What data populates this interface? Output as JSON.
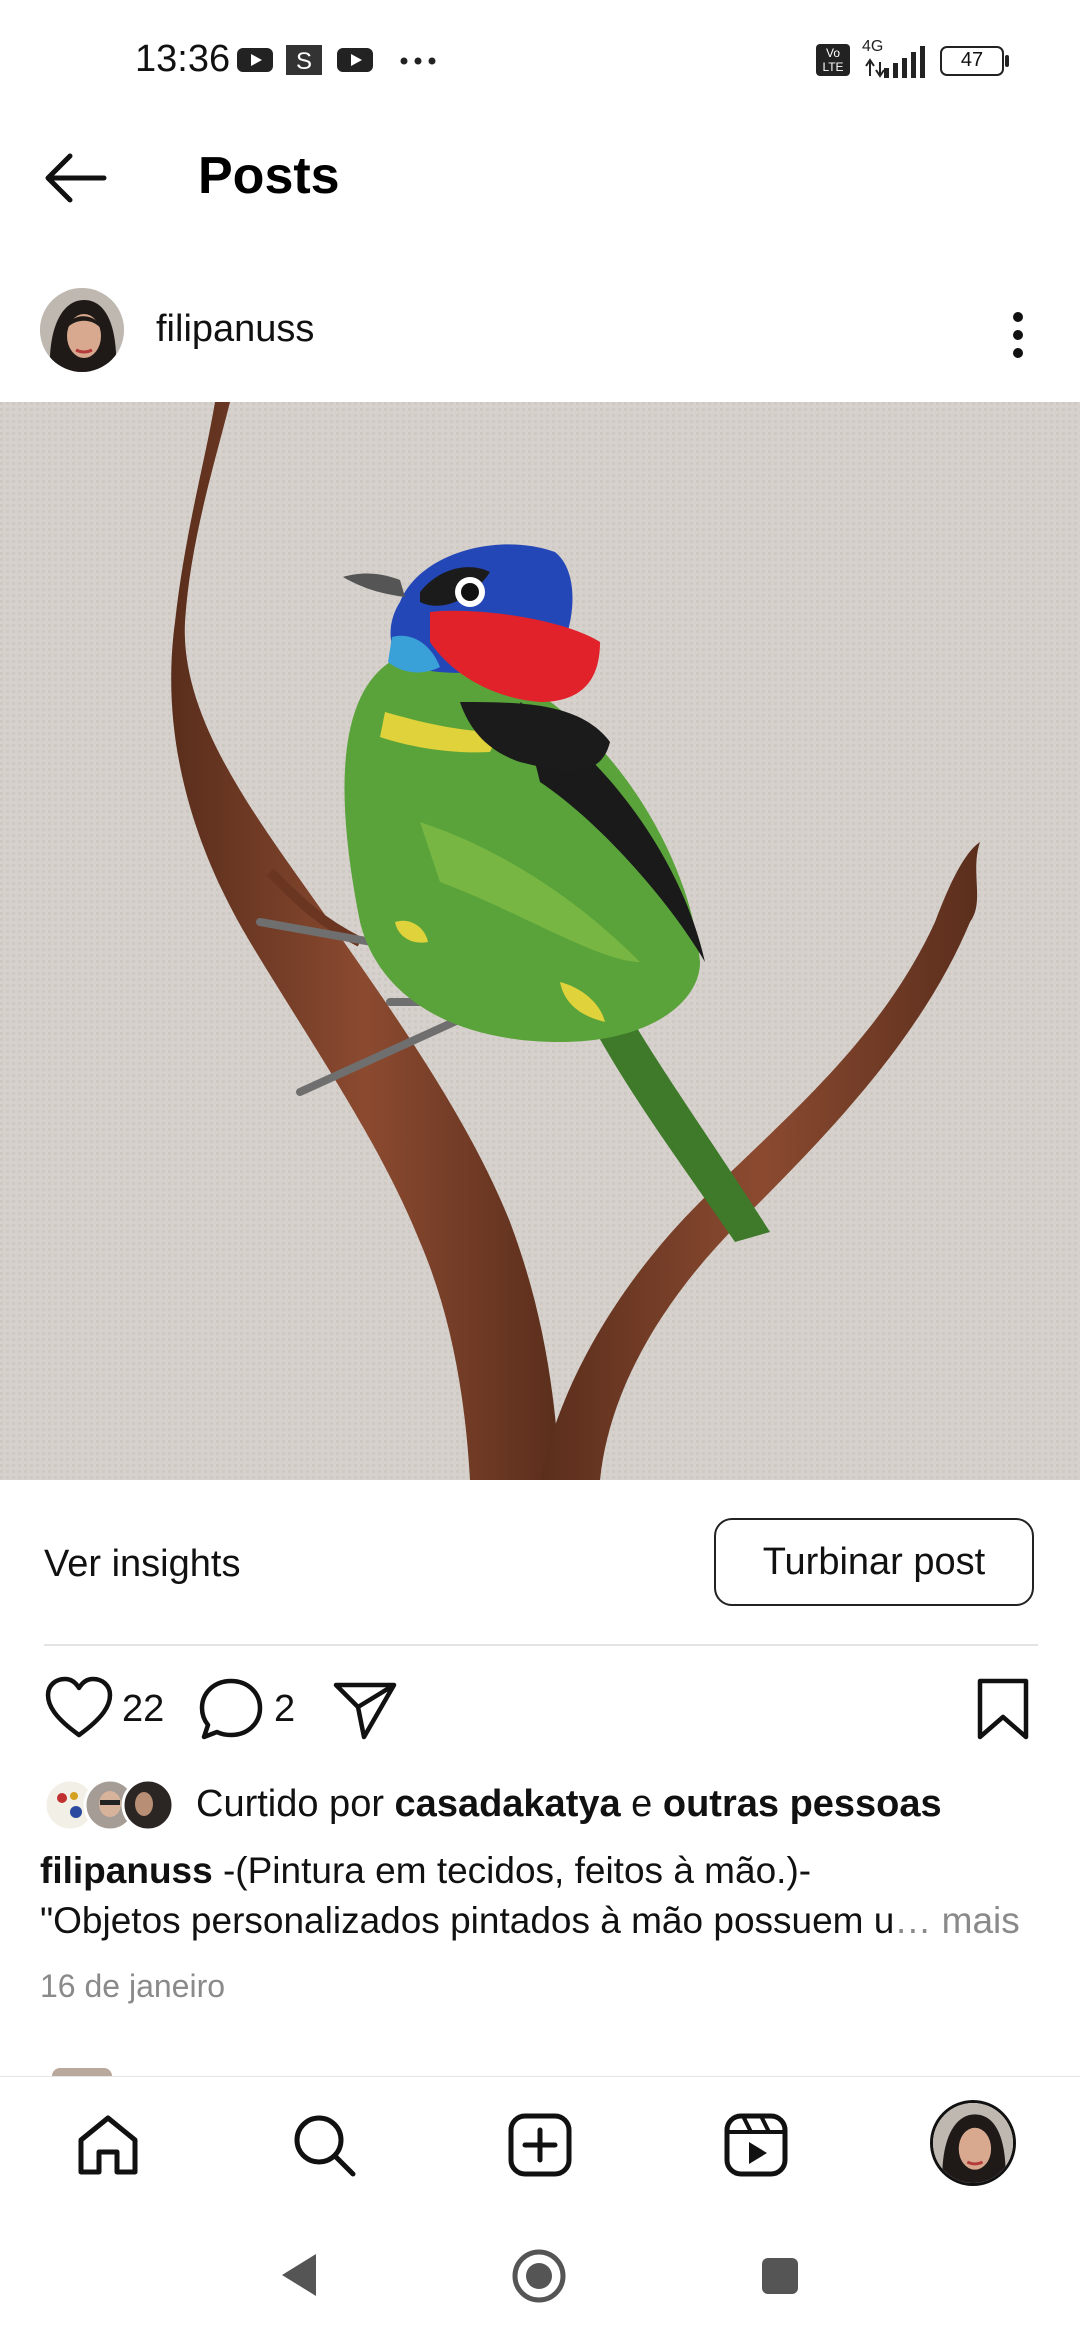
{
  "status_bar": {
    "time": "13:36",
    "network": "4G",
    "volte": "Vo LTE",
    "battery": "47"
  },
  "header": {
    "title": "Posts"
  },
  "post": {
    "username": "filipanuss",
    "insights_label": "Ver insights",
    "boost_label": "Turbinar post",
    "like_count": "22",
    "comment_count": "2",
    "liked_by_prefix": "Curtido por ",
    "liked_by_user": "casadakatya",
    "liked_by_and": " e ",
    "liked_by_others": "outras pessoas",
    "caption_user": "filipanuss",
    "caption_line1": " -(Pintura em tecidos, feitos à mão.)-",
    "caption_line2": "\"Objetos personalizados pintados à mão possuem u",
    "caption_ellipsis": "…",
    "caption_more": " mais",
    "date": "16 de janeiro"
  },
  "colors": {
    "accent_text": "#000000",
    "muted": "#8a8a8a"
  },
  "icons": {
    "back": "arrow-left-icon",
    "more": "more-vertical-icon",
    "like": "heart-icon",
    "comment": "comment-icon",
    "share": "send-icon",
    "save": "bookmark-icon",
    "nav": [
      "home-icon",
      "search-icon",
      "create-icon",
      "reels-icon",
      "profile-avatar"
    ]
  }
}
